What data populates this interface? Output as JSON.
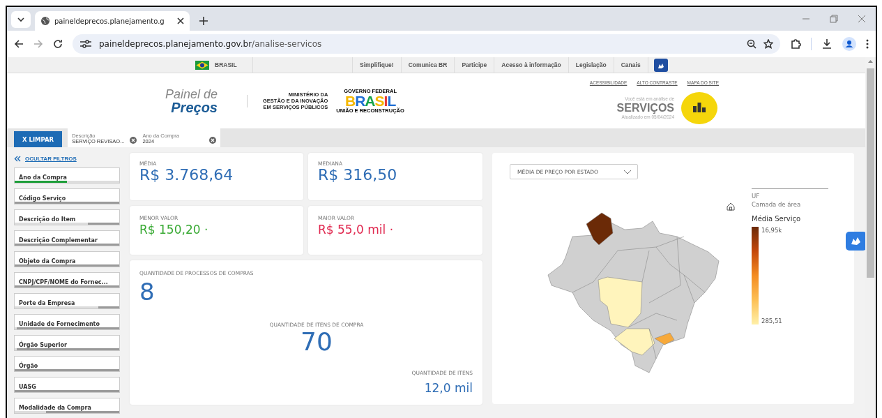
{
  "browser": {
    "tab_title": "paineldeprecos.planejamento.g",
    "url_host": "paineldeprecos.planejamento.gov.br",
    "url_path": "/analise-servicos"
  },
  "gov_bar": {
    "country": "BRASIL",
    "links": [
      "Simplifique!",
      "Comunica BR",
      "Participe",
      "Acesso à informação",
      "Legislação",
      "Canais"
    ]
  },
  "header": {
    "logo_top": "Painel de",
    "logo_bottom": "Preços",
    "ministry": [
      "MINISTÉRIO DA",
      "GESTÃO E DA INOVAÇÃO",
      "EM SERVIÇOS PÚBLICOS"
    ],
    "gov_top": "GOVERNO FEDERAL",
    "gov_word": "BRASIL",
    "gov_bottom": "UNIÃO E RECONSTRUÇÃO",
    "links": [
      "ACESSIBILIDADE",
      "ALTO CONTRASTE",
      "MAPA DO SITE"
    ],
    "context": "Você está em análise de",
    "section": "SERVIÇOS",
    "updated": "Atualizado em 05/04/2024"
  },
  "filter_bar": {
    "clear": "X LIMPAR",
    "chips": [
      {
        "label": "Descrição",
        "value": "SERVIÇO REVISAO..."
      },
      {
        "label": "Ano da Compra",
        "value": "2024"
      }
    ]
  },
  "sidebar": {
    "toggle": "OCULTAR FILTROS",
    "filters": [
      {
        "label": "Ano da Compra",
        "level": 0.5,
        "filtered": true
      },
      {
        "label": "Código Serviço",
        "level": 1,
        "filtered": false
      },
      {
        "label": "Descrição do Item",
        "level": 0.3,
        "filtered": false
      },
      {
        "label": "Descrição Complementar",
        "level": 1,
        "filtered": false
      },
      {
        "label": "Objeto da Compra",
        "level": 1,
        "filtered": false
      },
      {
        "label": "CNPJ/CPF/NOME do Fornec...",
        "level": 1,
        "filtered": false
      },
      {
        "label": "Porte da Empresa",
        "level": 0.2,
        "filtered": false
      },
      {
        "label": "Unidade de Fornecimento",
        "level": 0.98,
        "filtered": false
      },
      {
        "label": "Órgão Superior",
        "level": 0.98,
        "filtered": false
      },
      {
        "label": "Órgão",
        "level": 1,
        "filtered": false
      },
      {
        "label": "UASG",
        "level": 1,
        "filtered": false
      },
      {
        "label": "Modalidade da Compra",
        "level": 0.7,
        "filtered": false
      }
    ]
  },
  "stats": [
    {
      "label": "MÉDIA",
      "value": "R$ 3.768,64",
      "color": "#2f6db5"
    },
    {
      "label": "MEDIANA",
      "value": "R$ 316,50",
      "color": "#2f6db5"
    },
    {
      "label": "MENOR VALOR",
      "value": "R$ 150,20 ·",
      "color": "#3aaa35"
    },
    {
      "label": "MAIOR VALOR",
      "value": "R$ 55,0 mil ·",
      "color": "#e0284f"
    }
  ],
  "counts": [
    {
      "label": "QUANTIDADE DE PROCESSOS DE COMPRAS",
      "value": "8"
    },
    {
      "label": "QUANTIDADE DE ITENS DE COMPRA",
      "value": "70"
    },
    {
      "label": "QUANTIDADE DE ITENS",
      "value": "12,0 mil"
    }
  ],
  "map": {
    "dropdown": "MÉDIA DE PREÇO POR ESTADO",
    "legend_layer": "UF",
    "legend_sublayer": "Camada de área",
    "legend_title": "Média Serviço",
    "legend_max": "16,95k",
    "legend_min": "285,51"
  }
}
